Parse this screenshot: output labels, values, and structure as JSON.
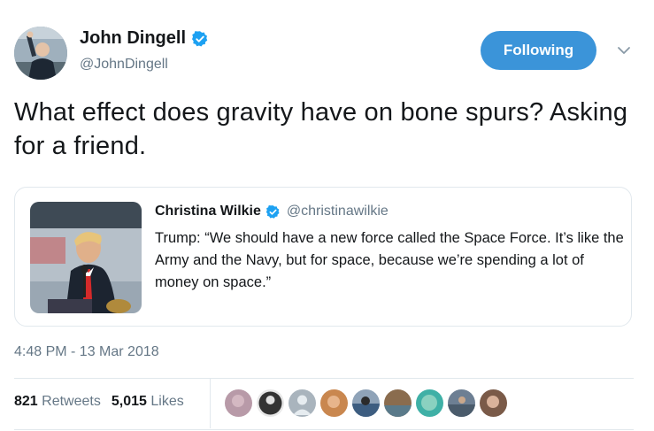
{
  "author": {
    "name": "John Dingell",
    "handle": "@JohnDingell",
    "verified": true,
    "avatar_icon": "profile-photo"
  },
  "follow_button": {
    "label": "Following",
    "color": "#3b94d9"
  },
  "menu_icon": "chevron-down-icon",
  "tweet": {
    "text": "What effect does gravity have on bone spurs? Asking for a friend."
  },
  "quoted_tweet": {
    "name": "Christina Wilkie",
    "handle": "@christinawilkie",
    "verified": true,
    "text": "Trump: “We should have a new force called the Space Force. It’s like the Army and the Navy, but for space, because we’re spending a lot of money on space.”",
    "image_icon": "press-photo"
  },
  "timestamp": "4:48 PM - 13 Mar 2018",
  "stats": {
    "retweets_count": "821",
    "retweets_label": "Retweets",
    "likes_count": "5,015",
    "likes_label": "Likes"
  },
  "likers": [
    {
      "icon": "liker-avatar",
      "color": "#b89aa8"
    },
    {
      "icon": "liker-avatar",
      "color": "#333333"
    },
    {
      "icon": "default-avatar",
      "color": "#a9b4bd"
    },
    {
      "icon": "liker-avatar",
      "color": "#c9874f"
    },
    {
      "icon": "liker-avatar",
      "color": "#3d5d80"
    },
    {
      "icon": "liker-avatar",
      "color": "#8a6c4e"
    },
    {
      "icon": "liker-avatar",
      "color": "#3fb0a6"
    },
    {
      "icon": "liker-avatar",
      "color": "#6d7f93"
    },
    {
      "icon": "liker-avatar",
      "color": "#7a5a48"
    }
  ],
  "colors": {
    "text_primary": "#14171a",
    "text_secondary": "#657786",
    "border": "#e1e8ed",
    "verified_blue": "#1da1f2"
  }
}
